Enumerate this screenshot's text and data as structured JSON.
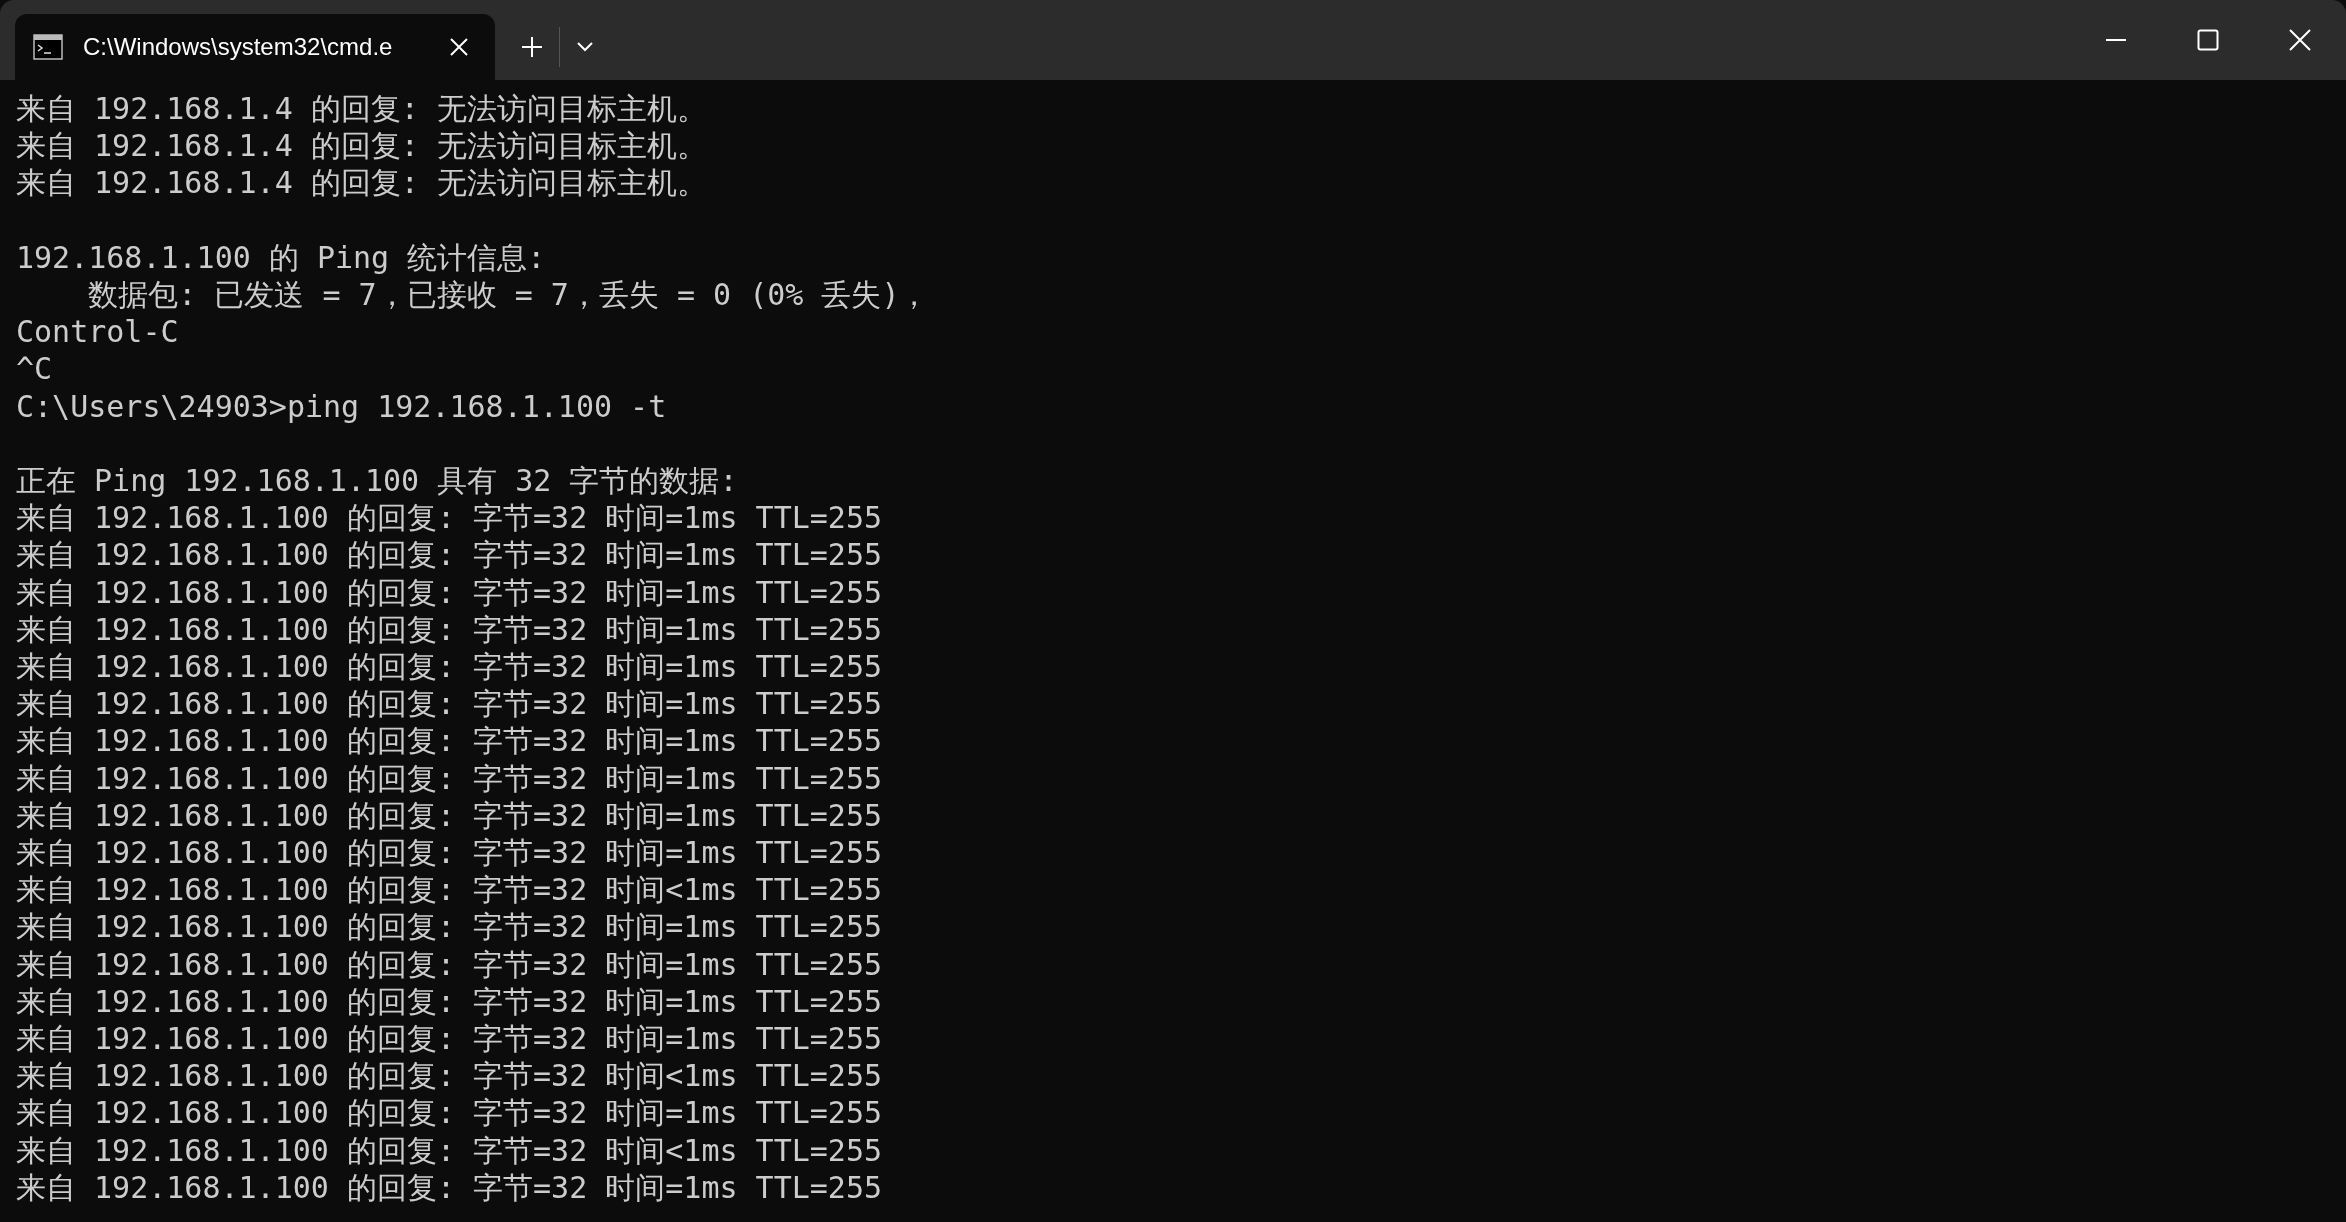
{
  "tab": {
    "title": "C:\\Windows\\system32\\cmd.e",
    "selected": true
  },
  "lines": [
    {
      "kind": "text",
      "text": "来自 192.168.1.4 的回复: 无法访问目标主机。"
    },
    {
      "kind": "text",
      "text": "来自 192.168.1.4 的回复: 无法访问目标主机。"
    },
    {
      "kind": "text",
      "text": "来自 192.168.1.4 的回复: 无法访问目标主机。"
    },
    {
      "kind": "blank"
    },
    {
      "kind": "text",
      "text": "192.168.1.100 的 Ping 统计信息:"
    },
    {
      "kind": "text",
      "text": "    数据包: 已发送 = 7，已接收 = 7，丢失 = 0 (0% 丢失)，"
    },
    {
      "kind": "text",
      "text": "Control-C"
    },
    {
      "kind": "text",
      "text": "^C"
    },
    {
      "kind": "text",
      "text": "C:\\Users\\24903>ping 192.168.1.100 -t"
    },
    {
      "kind": "blank"
    },
    {
      "kind": "text",
      "text": "正在 Ping 192.168.1.100 具有 32 字节的数据:"
    },
    {
      "kind": "text",
      "text": "来自 192.168.1.100 的回复: 字节=32 时间=1ms TTL=255"
    },
    {
      "kind": "text",
      "text": "来自 192.168.1.100 的回复: 字节=32 时间=1ms TTL=255"
    },
    {
      "kind": "text",
      "text": "来自 192.168.1.100 的回复: 字节=32 时间=1ms TTL=255"
    },
    {
      "kind": "text",
      "text": "来自 192.168.1.100 的回复: 字节=32 时间=1ms TTL=255"
    },
    {
      "kind": "text",
      "text": "来自 192.168.1.100 的回复: 字节=32 时间=1ms TTL=255"
    },
    {
      "kind": "text",
      "text": "来自 192.168.1.100 的回复: 字节=32 时间=1ms TTL=255"
    },
    {
      "kind": "text",
      "text": "来自 192.168.1.100 的回复: 字节=32 时间=1ms TTL=255"
    },
    {
      "kind": "text",
      "text": "来自 192.168.1.100 的回复: 字节=32 时间=1ms TTL=255"
    },
    {
      "kind": "text",
      "text": "来自 192.168.1.100 的回复: 字节=32 时间=1ms TTL=255"
    },
    {
      "kind": "text",
      "text": "来自 192.168.1.100 的回复: 字节=32 时间=1ms TTL=255"
    },
    {
      "kind": "text",
      "text": "来自 192.168.1.100 的回复: 字节=32 时间<1ms TTL=255"
    },
    {
      "kind": "text",
      "text": "来自 192.168.1.100 的回复: 字节=32 时间=1ms TTL=255"
    },
    {
      "kind": "text",
      "text": "来自 192.168.1.100 的回复: 字节=32 时间=1ms TTL=255"
    },
    {
      "kind": "text",
      "text": "来自 192.168.1.100 的回复: 字节=32 时间=1ms TTL=255"
    },
    {
      "kind": "text",
      "text": "来自 192.168.1.100 的回复: 字节=32 时间=1ms TTL=255"
    },
    {
      "kind": "text",
      "text": "来自 192.168.1.100 的回复: 字节=32 时间<1ms TTL=255"
    },
    {
      "kind": "text",
      "text": "来自 192.168.1.100 的回复: 字节=32 时间=1ms TTL=255"
    },
    {
      "kind": "text",
      "text": "来自 192.168.1.100 的回复: 字节=32 时间<1ms TTL=255"
    },
    {
      "kind": "text",
      "text": "来自 192.168.1.100 的回复: 字节=32 时间=1ms TTL=255"
    }
  ]
}
